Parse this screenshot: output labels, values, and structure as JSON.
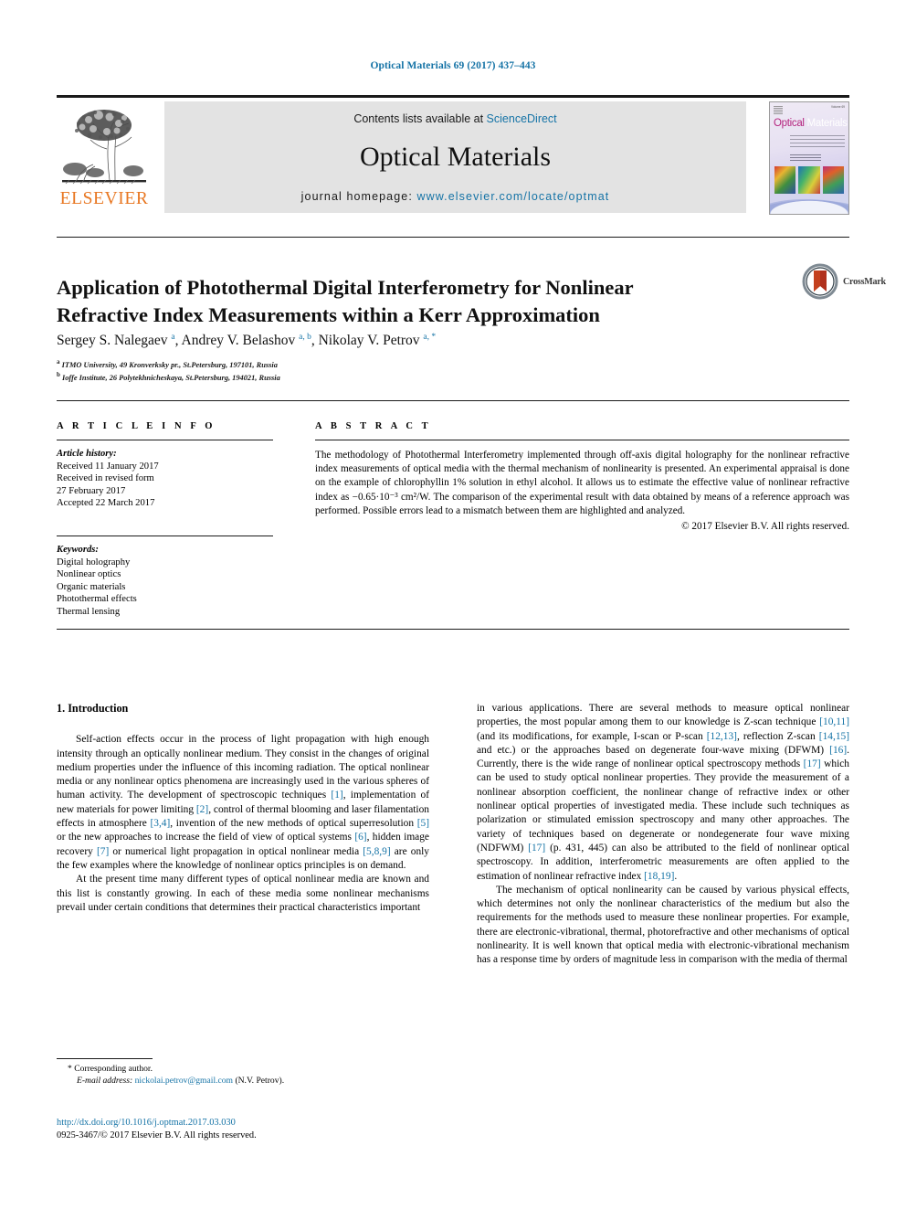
{
  "running_head": "Optical Materials 69 (2017) 437–443",
  "masthead": {
    "contents_prefix": "Contents lists available at ",
    "sciencedirect": "ScienceDirect",
    "journal_title": "Optical Materials",
    "homepage_label": "journal homepage: ",
    "homepage_url": "www.elsevier.com/locate/optmat",
    "publisher": "ELSEVIER",
    "cover": {
      "word1": "Optical",
      "word2": "Materials",
      "issue_label": "Volume 69"
    },
    "link_color": "#1573a6"
  },
  "article": {
    "title": "Application of Photothermal Digital Interferometry for Nonlinear Refractive Index Measurements within a Kerr Approximation",
    "crossmark_label": "CrossMark",
    "authors": [
      {
        "name": "Sergey S. Nalegaev",
        "marks": "a"
      },
      {
        "name": "Andrey V. Belashov",
        "marks": "a, b"
      },
      {
        "name": "Nikolay V. Petrov",
        "marks": "a, *"
      }
    ],
    "affiliations": [
      {
        "mark": "a",
        "text": "ITMO University, 49 Kronverksky pr., St.Petersburg, 197101, Russia"
      },
      {
        "mark": "b",
        "text": "Ioffe Institute, 26 Polytekhnicheskaya, St.Petersburg, 194021, Russia"
      }
    ]
  },
  "article_info": {
    "heading": "A R T I C L E  I N F O",
    "history_label": "Article history:",
    "history": [
      "Received 11 January 2017",
      "Received in revised form",
      "27 February 2017",
      "Accepted 22 March 2017"
    ],
    "keywords_label": "Keywords:",
    "keywords": [
      "Digital holography",
      "Nonlinear optics",
      "Organic materials",
      "Photothermal effects",
      "Thermal lensing"
    ]
  },
  "abstract": {
    "heading": "A B S T R A C T",
    "text": "The methodology of Photothermal Interferometry implemented through off-axis digital holography for the nonlinear refractive index measurements of optical media with the thermal mechanism of nonlinearity is presented. An experimental appraisal is done on the example of chlorophyllin 1% solution in ethyl alcohol. It allows us to estimate the effective value of nonlinear refractive index as −0.65·10⁻³ cm²/W. The comparison of the experimental result with data obtained by means of a reference approach was performed. Possible errors lead to a mismatch between them are highlighted and analyzed.",
    "copyright": "© 2017 Elsevier B.V. All rights reserved."
  },
  "body": {
    "section_heading": "1.  Introduction",
    "left_paragraphs": [
      "Self-action effects occur in the process of light propagation with high enough intensity through an optically nonlinear medium. They consist in the changes of original medium properties under the influence of this incoming radiation. The optical nonlinear media or any nonlinear optics phenomena are increasingly used in the various spheres of human activity. The development of spectroscopic techniques [1], implementation of new materials for power limiting [2], control of thermal blooming and laser filamentation effects in atmosphere [3,4], invention of the new methods of optical superresolution [5] or the new approaches to increase the field of view of optical systems [6], hidden image recovery [7] or numerical light propagation in optical nonlinear media [5,8,9] are only the few examples where the knowledge of nonlinear optics principles is on demand.",
      "At the present time many different types of optical nonlinear media are known and this list is constantly growing. In each of these media some nonlinear mechanisms prevail under certain conditions that determines their practical characteristics important"
    ],
    "right_paragraphs": [
      "in various applications. There are several methods to measure optical nonlinear properties, the most popular among them to our knowledge is Z-scan technique [10,11] (and its modifications, for example, I-scan or P-scan [12,13], reflection Z-scan [14,15] and etc.) or the approaches based on degenerate four-wave mixing (DFWM) [16]. Currently, there is the wide range of nonlinear optical spectroscopy methods [17] which can be used to study optical nonlinear properties. They provide the measurement of a nonlinear absorption coefficient, the nonlinear change of refractive index or other nonlinear optical properties of investigated media. These include such techniques as polarization or stimulated emission spectroscopy and many other approaches. The variety of techniques based on degenerate or nondegenerate four wave mixing (NDFWM) [17] (p. 431, 445) can also be attributed to the field of nonlinear optical spectroscopy. In addition, interferometric measurements are often applied to the estimation of nonlinear refractive index [18,19].",
      "The mechanism of optical nonlinearity can be caused by various physical effects, which determines not only the nonlinear characteristics of the medium but also the requirements for the methods used to measure these nonlinear properties. For example, there are electronic-vibrational, thermal, photorefractive and other mechanisms of optical nonlinearity. It is well known that optical media with electronic-vibrational mechanism has a response time by orders of magnitude less in comparison with the media of thermal"
    ]
  },
  "footnote": {
    "corresponding": "* Corresponding author.",
    "email_label": "E-mail address:",
    "email": "nickolai.petrov@gmail.com",
    "email_owner": "(N.V. Petrov)."
  },
  "footer": {
    "doi": "http://dx.doi.org/10.1016/j.optmat.2017.03.030",
    "issn_line": "0925-3467/© 2017 Elsevier B.V. All rights reserved."
  }
}
